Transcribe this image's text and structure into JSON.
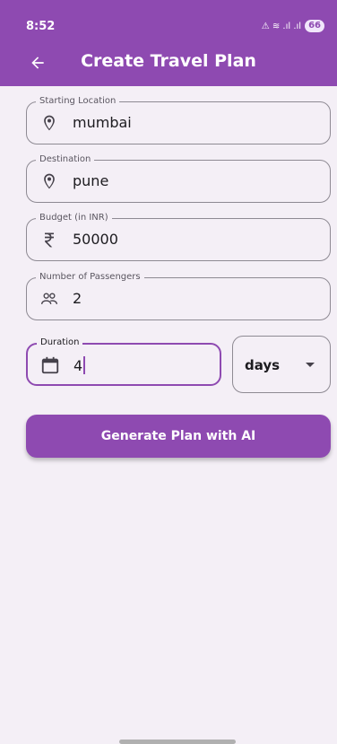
{
  "status_bar": {
    "time": "8:52",
    "signal_text": "⚠ ≋ .ıl .ıl",
    "battery": "66"
  },
  "header": {
    "title": "Create Travel Plan",
    "back_icon": "arrow-back-icon"
  },
  "form": {
    "starting_location": {
      "label": "Starting Location",
      "value": "mumbai",
      "icon": "location-pin-icon"
    },
    "destination": {
      "label": "Destination",
      "value": "pune",
      "icon": "location-pin-icon"
    },
    "budget": {
      "label": "Budget (in INR)",
      "value": "50000",
      "icon": "rupee-icon"
    },
    "passengers": {
      "label": "Number of Passengers",
      "value": "2",
      "icon": "people-icon"
    },
    "duration": {
      "label": "Duration",
      "value": "4",
      "icon": "calendar-icon",
      "unit": "days"
    }
  },
  "actions": {
    "generate_label": "Generate Plan with AI"
  },
  "colors": {
    "primary": "#8e4ab1",
    "background": "#f4eff6"
  }
}
